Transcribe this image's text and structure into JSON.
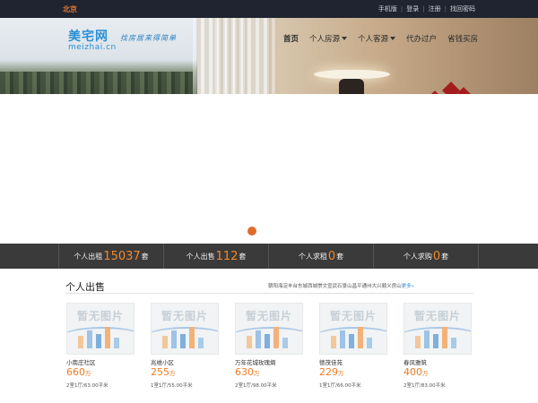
{
  "topbar": {
    "city": "北京",
    "links": [
      "手机版",
      "登录",
      "注册",
      "找回密码"
    ]
  },
  "header": {
    "logo_cn": "美宅网",
    "logo_en": "meizhai.cn",
    "slogan": "找房居来得简单",
    "nav": [
      {
        "label": "首页",
        "active": true,
        "dropdown": false
      },
      {
        "label": "个人房源",
        "active": false,
        "dropdown": true
      },
      {
        "label": "个人客源",
        "active": false,
        "dropdown": true
      },
      {
        "label": "代办过户",
        "active": false,
        "dropdown": false
      },
      {
        "label": "省钱买房",
        "active": false,
        "dropdown": false
      }
    ]
  },
  "stats": [
    {
      "label": "个人出租",
      "count": "15037",
      "unit": "套"
    },
    {
      "label": "个人出售",
      "count": "112",
      "unit": "套"
    },
    {
      "label": "个人求租",
      "count": "0",
      "unit": "套"
    },
    {
      "label": "个人求购",
      "count": "0",
      "unit": "套"
    }
  ],
  "section": {
    "title": "个人出售",
    "districts": [
      "朝阳",
      "海淀",
      "丰台",
      "东城",
      "西城",
      "崇文",
      "宣武",
      "石景山",
      "昌平",
      "通州",
      "大兴",
      "顺义",
      "房山"
    ],
    "more": "更多»"
  },
  "listings": [
    {
      "placeholder": "暂无图片",
      "name": "小南庄社区",
      "price": "660",
      "unit": "万",
      "meta": "2室1厅/63.00平米"
    },
    {
      "placeholder": "暂无图片",
      "name": "兆维小区",
      "price": "255",
      "unit": "万",
      "meta": "1室1厅/55.00平米"
    },
    {
      "placeholder": "暂无图片",
      "name": "万年花城玫瑰熵",
      "price": "630",
      "unit": "万",
      "meta": "2室1厅/98.00平米"
    },
    {
      "placeholder": "暂无图片",
      "name": "德茂佳苑",
      "price": "229",
      "unit": "万",
      "meta": "1室1厅/66.00平米"
    },
    {
      "placeholder": "暂无图片",
      "name": "春风雅筑",
      "price": "400",
      "unit": "万",
      "meta": "2室1厅/83.00平米"
    }
  ],
  "colors": {
    "accent": "#f07a22",
    "topbar": "#1f2430",
    "stats_bar": "#3a3a3a",
    "brand_blue": "#2a8fd6"
  }
}
